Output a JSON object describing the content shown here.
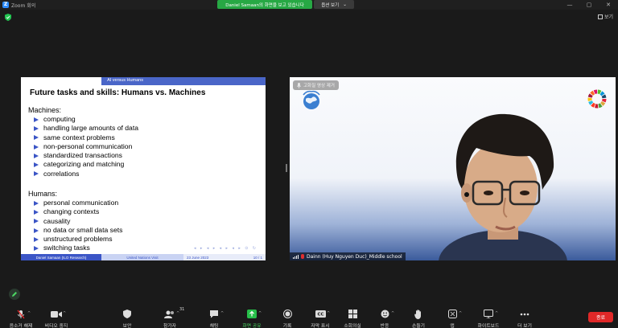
{
  "window": {
    "title": "Zoom 회의",
    "app_initial": "Z",
    "share_banner": "Daniel Samaan의 화면을 보고 있습니다",
    "view_options": "옵션 보기",
    "view_options_caret": "⌄",
    "controls": [
      "—",
      "▢",
      "✕"
    ],
    "view_label": "보기"
  },
  "slide": {
    "header": "AI versus Humans",
    "title": "Future tasks and skills: Humans vs. Machines",
    "machines_label": "Machines:",
    "machines": [
      "computing",
      "handling large amounts of data",
      "same context problems",
      "non-personal communication",
      "standardized transactions",
      "categorizing and matching",
      "correlations"
    ],
    "humans_label": "Humans:",
    "humans": [
      "personal communication",
      "changing contexts",
      "causality",
      "no data or small data sets",
      "unstructured problems",
      "switching tasks"
    ],
    "nav_symbols": "◂ ▸ ◂ ▸ ◂ ▸ ◂ ▸ ⊙ ↻",
    "footer": {
      "author": "Daniel Samaan  (ILO Research)",
      "event": "United Nations Visit",
      "date": "23 June 2023",
      "page": "10 / 1"
    }
  },
  "video": {
    "label": "고화질 영상 제거",
    "name_tag": "Dainn (Huy Nguyen Duc)_Middle school"
  },
  "toolbar": {
    "items": [
      {
        "label": "음소거 해제",
        "icon": "mic-muted-icon"
      },
      {
        "label": "비디오 중지",
        "icon": "video-icon"
      },
      {
        "label": "보안",
        "icon": "shield-icon"
      },
      {
        "label": "참가자",
        "icon": "participants-icon",
        "count": "31"
      },
      {
        "label": "채팅",
        "icon": "chat-icon"
      },
      {
        "label": "화면 공유",
        "icon": "share-screen-icon"
      },
      {
        "label": "기록",
        "icon": "record-icon"
      },
      {
        "label": "자막 표시",
        "icon": "cc-icon"
      },
      {
        "label": "소회의실",
        "icon": "breakout-icon"
      },
      {
        "label": "반응",
        "icon": "reaction-icon"
      },
      {
        "label": "손들기",
        "icon": "raise-hand-icon"
      },
      {
        "label": "앱",
        "icon": "apps-icon"
      },
      {
        "label": "화이트보드",
        "icon": "whiteboard-icon"
      },
      {
        "label": "더 보기",
        "icon": "more-icon"
      }
    ],
    "end": "종료"
  },
  "colors": {
    "accent_green": "#27a844",
    "end_red": "#e02828",
    "slide_blue": "#3b55c6"
  }
}
